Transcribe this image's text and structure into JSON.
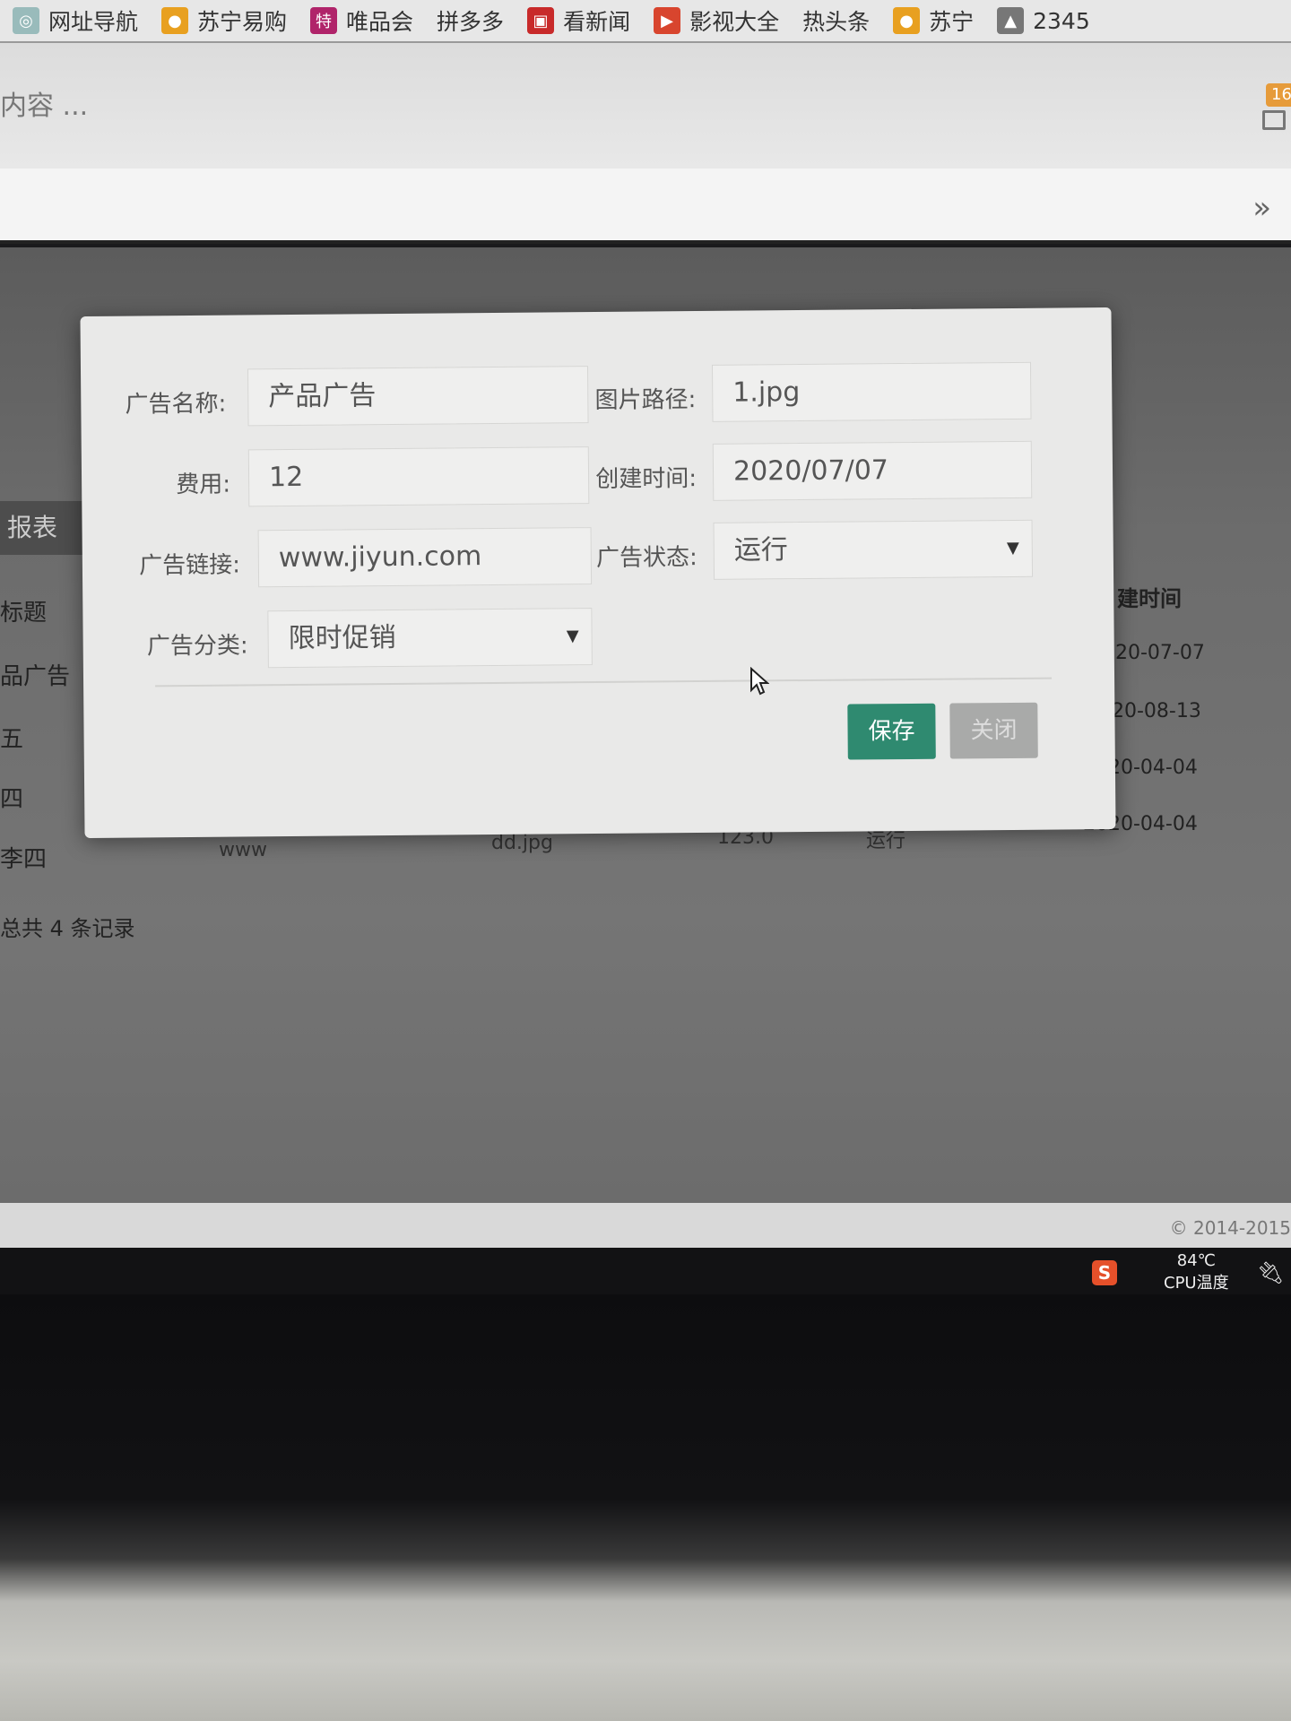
{
  "bookmarks": [
    {
      "icon": "globe-icon",
      "label": "网址导航"
    },
    {
      "icon": "suning-icon",
      "label": "苏宁易购"
    },
    {
      "icon": "vip-icon",
      "label": "唯品会"
    },
    {
      "icon": "",
      "label": "拼多多"
    },
    {
      "icon": "news-icon",
      "label": "看新闻"
    },
    {
      "icon": "play-icon",
      "label": "影视大全"
    },
    {
      "icon": "",
      "label": "热头条"
    },
    {
      "icon": "suning-icon",
      "label": "苏宁"
    },
    {
      "icon": "2345-icon",
      "label": "2345"
    }
  ],
  "header": {
    "search_text": "内容 ...",
    "message_count": "16"
  },
  "page": {
    "side_tab": "报表",
    "row_labels": [
      "标题",
      "品广告",
      "五",
      "四",
      "李四"
    ],
    "date_column_header": "建时间",
    "dates": [
      "20-07-07",
      "20-08-13",
      "20-04-04",
      "2020-04-04"
    ],
    "partial_row": [
      "www",
      "dd.jpg",
      "123.0",
      "运行"
    ],
    "total_records": "总共 4 条记录",
    "copyright": "© 2014-2015"
  },
  "taskbar": {
    "cpu_temp": "84℃",
    "cpu_label": "CPU温度"
  },
  "modal": {
    "fields": {
      "ad_name": {
        "label": "广告名称:",
        "value": "产品广告"
      },
      "image_path": {
        "label": "图片路径:",
        "value": "1.jpg"
      },
      "cost": {
        "label": "费用:",
        "value": "12"
      },
      "created_time": {
        "label": "创建时间:",
        "value": "2020/07/07"
      },
      "ad_link": {
        "label": "广告链接:",
        "value": "www.jiyun.com"
      },
      "ad_status": {
        "label": "广告状态:",
        "value": "运行"
      },
      "ad_category": {
        "label": "广告分类:",
        "value": "限时促销"
      }
    },
    "save_label": "保存",
    "close_label": "关闭",
    "colors": {
      "save": "#2f8a70",
      "close": "#a9aaa9"
    }
  }
}
